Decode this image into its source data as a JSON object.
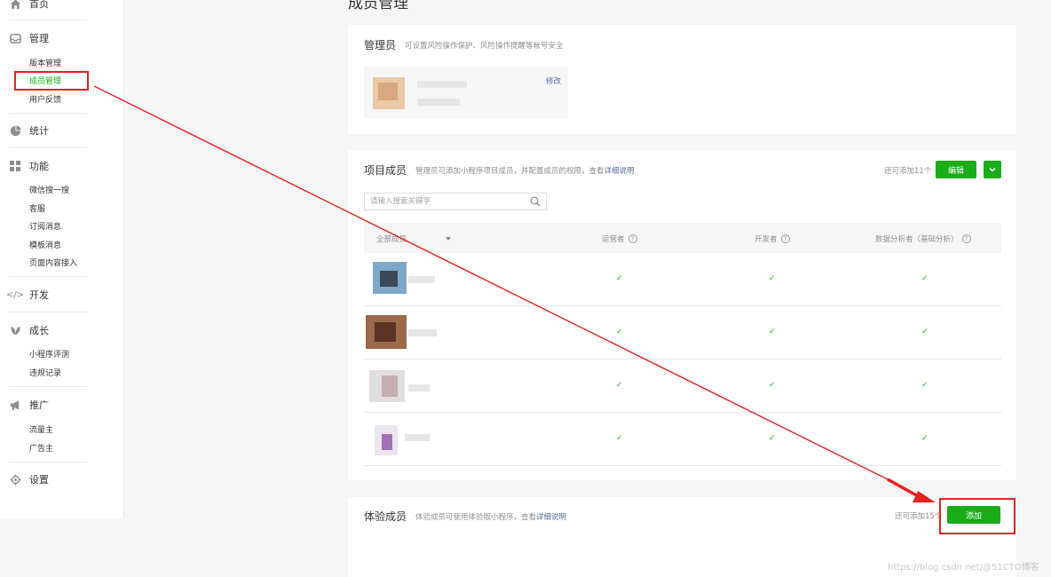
{
  "sidebar": {
    "home": "首页",
    "manage": {
      "label": "管理",
      "items": [
        "版本管理",
        "成员管理",
        "用户反馈"
      ]
    },
    "stats": {
      "label": "统计"
    },
    "features": {
      "label": "功能",
      "items": [
        "微信搜一搜",
        "客服",
        "订阅消息",
        "模板消息",
        "页面内容接入"
      ]
    },
    "dev": {
      "label": "开发"
    },
    "growth": {
      "label": "成长",
      "items": [
        "小程序评测",
        "违规记录"
      ]
    },
    "promo": {
      "label": "推广",
      "items": [
        "流量主",
        "广告主"
      ]
    },
    "settings": {
      "label": "设置"
    }
  },
  "page": {
    "title": "成员管理"
  },
  "admin_card": {
    "title": "管理员",
    "desc": "可设置风险操作保护、风险操作提醒等帐号安全",
    "edit_link": "修改"
  },
  "project_card": {
    "title": "项目成员",
    "desc_prefix": "管理员可添加小程序项目成员，并配置成员的权限，查看",
    "desc_link": "详细说明",
    "remaining": "还可添加11个",
    "edit_button": "编辑",
    "dropdown_icon": "chevron-down-icon",
    "search_placeholder": "请输入搜索关键字",
    "columns": [
      "全部成员",
      "运营者",
      "开发者",
      "数据分析者（基础分析）"
    ],
    "rows": [
      {
        "operator": "✓",
        "developer": "✓",
        "analyst": "✓"
      },
      {
        "operator": "✓",
        "developer": "✓",
        "analyst": "✓"
      },
      {
        "operator": "✓",
        "developer": "✓",
        "analyst": "✓"
      },
      {
        "operator": "✓",
        "developer": "✓",
        "analyst": "✓"
      }
    ]
  },
  "trial_card": {
    "title": "体验成员",
    "desc_prefix": "体验成员可使用体验版小程序，查看",
    "desc_link": "详细说明",
    "remaining": "还可添加15个",
    "add_button": "添加"
  },
  "watermark": "https://blog.csdn.net/@51CTO博客",
  "colors": {
    "accent": "#1aad19",
    "annotation": "#e82121",
    "link": "#576b95"
  }
}
